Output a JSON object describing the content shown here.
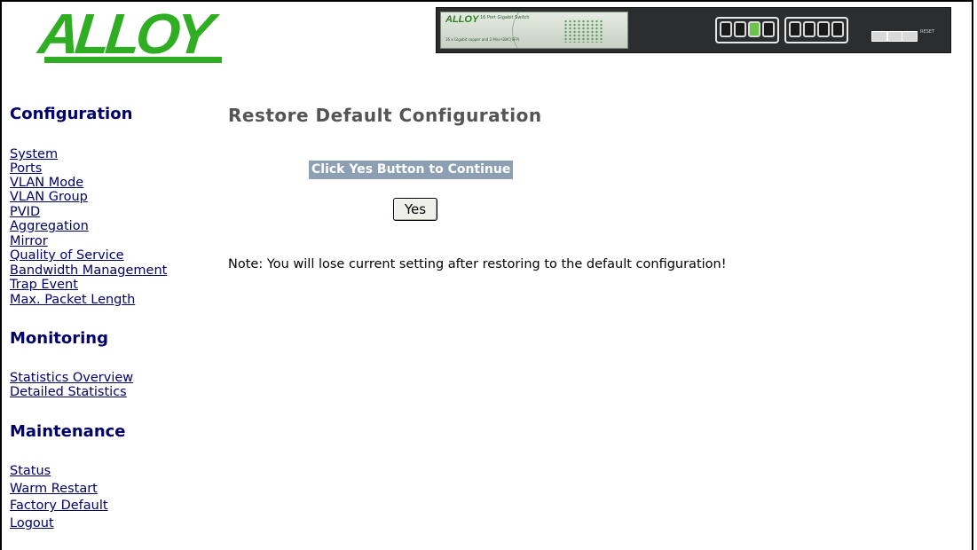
{
  "brand": {
    "logo_text": "ALLOY"
  },
  "banner": {
    "device_brand": "ALLOY",
    "device_model": "16 Port Gigabit Switch",
    "device_sub": "16 x Gigabit copper and 2 Mini-GBIC(SFP)",
    "reset_label": "RESET"
  },
  "sidebar": {
    "configuration": {
      "title": "Configuration",
      "items": [
        "System",
        "Ports",
        "VLAN Mode",
        "VLAN Group",
        "PVID",
        "Aggregation",
        "Mirror",
        "Quality of Service",
        "Bandwidth Management",
        "Trap Event",
        "Max. Packet Length"
      ]
    },
    "monitoring": {
      "title": "Monitoring",
      "items": [
        "Statistics Overview",
        "Detailed Statistics"
      ]
    },
    "maintenance": {
      "title": "Maintenance",
      "items": [
        "Status",
        "Warm Restart",
        "Factory Default",
        "Logout"
      ]
    }
  },
  "main": {
    "title": "Restore Default Configuration",
    "instruction": "Click Yes Button to Continue",
    "yes_button": "Yes",
    "note": "Note: You will lose current setting after restoring to the default configuration!"
  },
  "colors": {
    "logo_green": "#2fae24",
    "nav_link": "#00006b",
    "title_gray": "#555555",
    "instruction_bg": "#8c9fb3"
  }
}
